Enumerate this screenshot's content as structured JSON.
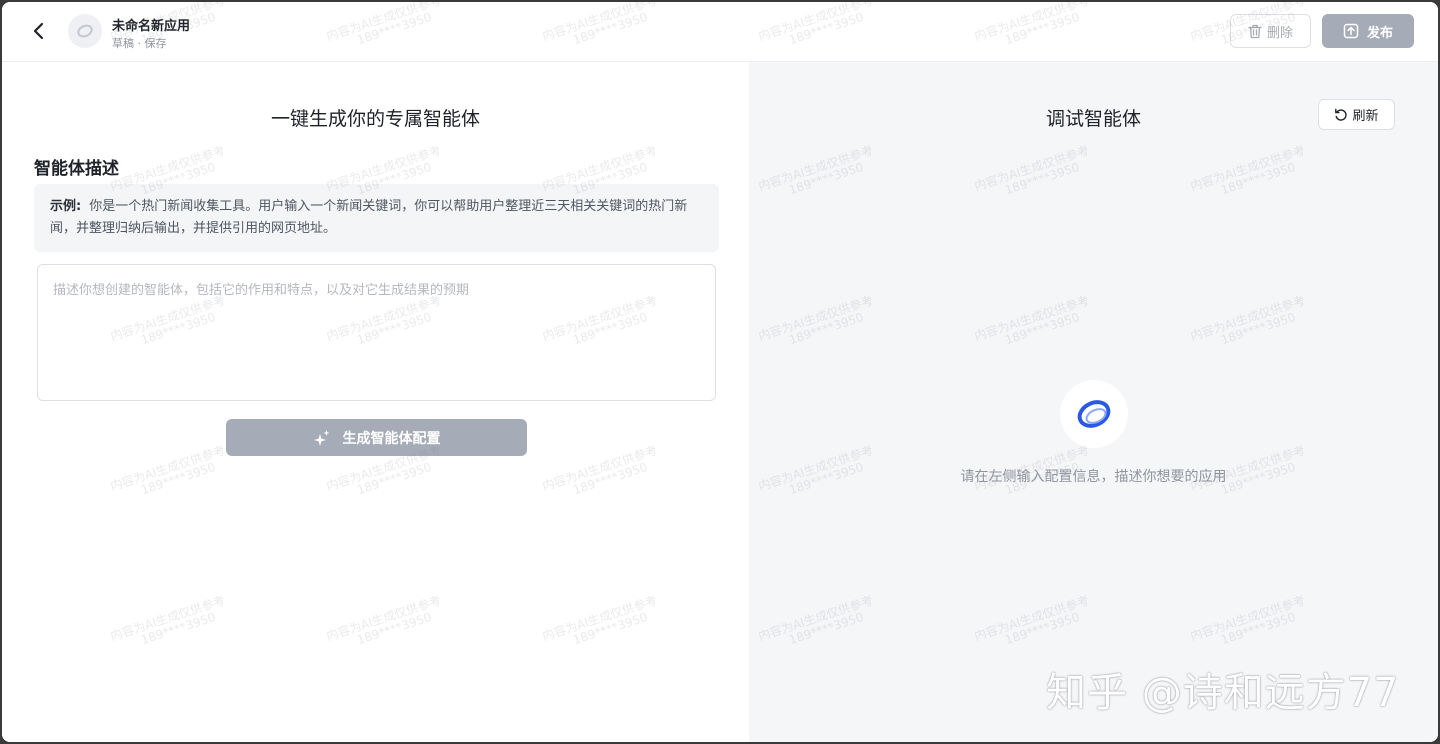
{
  "header": {
    "app_title": "未命名新应用",
    "app_status": "草稿 · 保存",
    "delete_label": "删除",
    "publish_label": "发布"
  },
  "left": {
    "title": "一键生成你的专属智能体",
    "section_label": "智能体描述",
    "example_label": "示例:",
    "example_text": "你是一个热门新闻收集工具。用户输入一个新闻关键词，你可以帮助用户整理近三天相关关键词的热门新闻，并整理归纳后输出，并提供引用的网页地址。",
    "description_value": "",
    "description_placeholder": "描述你想创建的智能体，包括它的作用和特点，以及对它生成结果的预期",
    "generate_label": "生成智能体配置"
  },
  "right": {
    "title": "调试智能体",
    "refresh_label": "刷新",
    "empty_hint": "请在左侧输入配置信息，描述你想要的应用"
  },
  "watermark": {
    "line1": "内容为AI生成仅供参考",
    "line2": "189****3950",
    "corner": "知乎 @诗和远方77"
  },
  "colors": {
    "primary_disabled": "#a5acb8",
    "brand_blue": "#2b59e6",
    "right_bg": "#f5f6f8"
  },
  "icons": {
    "back": "chevron-left-icon",
    "avatar": "app-avatar-icon",
    "delete": "trash-icon",
    "publish": "upload-icon",
    "generate": "sparkle-icon",
    "refresh": "refresh-icon",
    "logo": "brand-logo-icon"
  }
}
